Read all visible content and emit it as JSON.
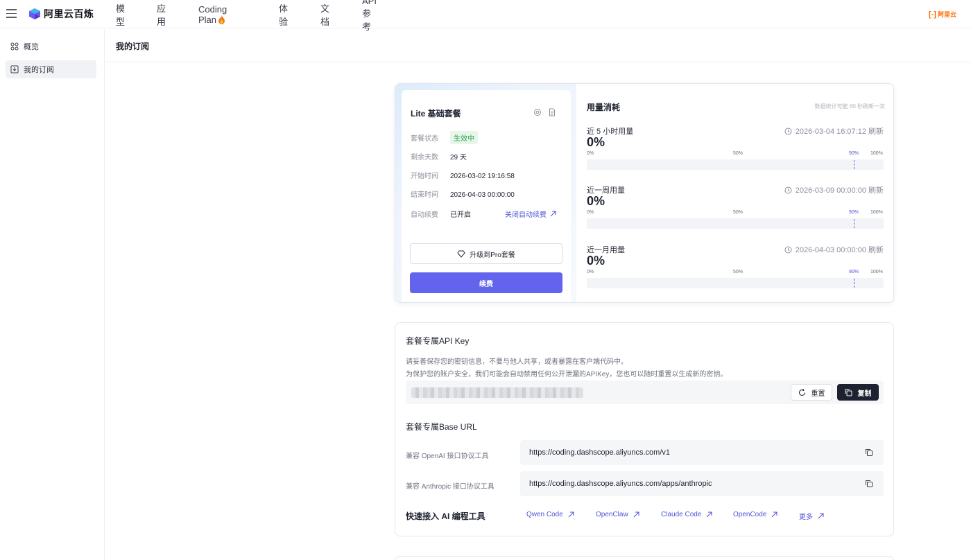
{
  "nav": {
    "brand": "阿里云百炼",
    "items": [
      "模型",
      "应用",
      "Coding Plan",
      "体验",
      "文档",
      "API 参考"
    ],
    "right_brand_mark": "[-]",
    "right_brand_text": "阿里云"
  },
  "sidebar": {
    "items": [
      {
        "label": "概览",
        "icon": "grid-icon"
      },
      {
        "label": "我的订阅",
        "icon": "subscription-icon"
      }
    ]
  },
  "page": {
    "title": "我的订阅"
  },
  "plan": {
    "title": "Lite 基础套餐",
    "fields": [
      {
        "key": "套餐状态",
        "value": "生效中"
      },
      {
        "key": "剩余天数",
        "value": "29 天"
      },
      {
        "key": "开始时间",
        "value": "2026-03-02 19:16:58"
      },
      {
        "key": "结束时间",
        "value": "2026-04-03 00:00:00"
      },
      {
        "key": "自动续费",
        "value": "已开启"
      }
    ],
    "close_auto_renew": "关闭自动续费",
    "upgrade_label": "升级到Pro套餐",
    "renew_label": "续费"
  },
  "usage": {
    "title": "用量消耗",
    "note": "数据统计可能 60 秒刷新一次",
    "ticks": [
      "0%",
      "50%",
      "90%",
      "100%"
    ],
    "blocks": [
      {
        "label": "近 5 小时用量",
        "time": "2026-03-04 16:07:12 刷新",
        "percent_text": "0%",
        "fill": 0
      },
      {
        "label": "近一周用量",
        "time": "2026-03-09 00:00:00 刷新",
        "percent_text": "0%",
        "fill": 0
      },
      {
        "label": "近一月用量",
        "time": "2026-04-03 00:00:00 刷新",
        "percent_text": "0%",
        "fill": 0
      }
    ]
  },
  "apikey": {
    "title": "套餐专属API Key",
    "desc1": "请妥善保存您的密钥信息，不要与他人共享，或者暴露在客户端代码中。",
    "desc2": "为保护您的账户安全，我们可能会自动禁用任何公开泄漏的APIKey，您也可以随时重置以生成新的密钥。",
    "reset_label": "重置",
    "copy_label": "复制"
  },
  "base_url": {
    "title": "套餐专属Base URL",
    "rows": [
      {
        "label": "兼容 OpenAI 接口协议工具",
        "url": "https://coding.dashscope.aliyuncs.com/v1"
      },
      {
        "label": "兼容 Anthropic 接口协议工具",
        "url": "https://coding.dashscope.aliyuncs.com/apps/anthropic"
      }
    ]
  },
  "quick": {
    "title": "快速接入 AI 编程工具",
    "links": [
      "Qwen Code",
      "OpenClaw",
      "Claude Code",
      "OpenCode",
      "更多"
    ]
  },
  "colors": {
    "accent": "#6363ee",
    "link": "#4f52d8",
    "status_green": "#2aa04a",
    "brand_orange": "#ff6a00"
  }
}
